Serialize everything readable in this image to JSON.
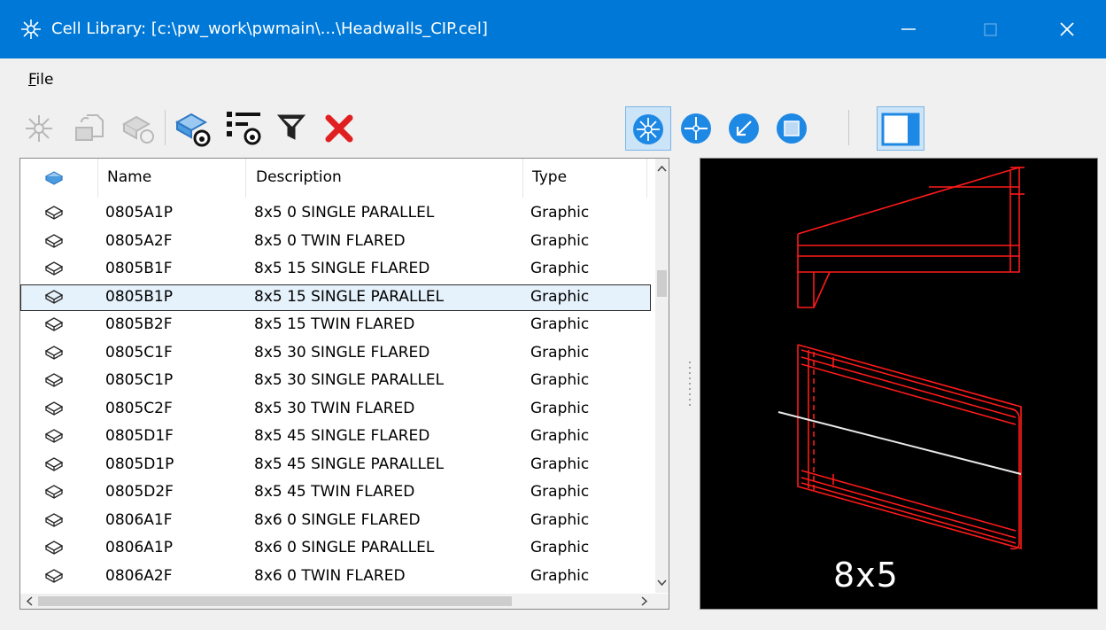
{
  "window": {
    "title": "Cell Library: [c:\\pw_work\\pwmain\\...\\Headwalls_CIP.cel]"
  },
  "menu": {
    "file_prefix": "F",
    "file_rest": "ile"
  },
  "toolbar": {
    "left_icons": [
      "place-cell-icon",
      "create-cell-icon",
      "update-cell-icon",
      "show-cells-icon",
      "show-details-icon",
      "filter-icon",
      "delete-icon"
    ],
    "right_icons": [
      "placement-active-point-icon",
      "placement-center-icon",
      "placement-origin-icon",
      "placement-fit-icon",
      "preview-pane-toggle-icon"
    ]
  },
  "table": {
    "columns": [
      "Name",
      "Description",
      "Type"
    ],
    "rows": [
      {
        "name": "0805A1P",
        "description": "8x5 0 SINGLE PARALLEL",
        "type": "Graphic"
      },
      {
        "name": "0805A2F",
        "description": "8x5 0 TWIN FLARED",
        "type": "Graphic"
      },
      {
        "name": "0805B1F",
        "description": "8x5 15 SINGLE FLARED",
        "type": "Graphic"
      },
      {
        "name": "0805B1P",
        "description": "8x5 15 SINGLE PARALLEL",
        "type": "Graphic",
        "selected": true
      },
      {
        "name": "0805B2F",
        "description": "8x5 15 TWIN FLARED",
        "type": "Graphic"
      },
      {
        "name": "0805C1F",
        "description": "8x5 30 SINGLE FLARED",
        "type": "Graphic"
      },
      {
        "name": "0805C1P",
        "description": "8x5 30 SINGLE PARALLEL",
        "type": "Graphic"
      },
      {
        "name": "0805C2F",
        "description": "8x5 30 TWIN FLARED",
        "type": "Graphic"
      },
      {
        "name": "0805D1F",
        "description": "8x5 45 SINGLE FLARED",
        "type": "Graphic"
      },
      {
        "name": "0805D1P",
        "description": "8x5 45 SINGLE PARALLEL",
        "type": "Graphic"
      },
      {
        "name": "0805D2F",
        "description": "8x5 45 TWIN FLARED",
        "type": "Graphic"
      },
      {
        "name": "0806A1F",
        "description": "8x6 0 SINGLE FLARED",
        "type": "Graphic"
      },
      {
        "name": "0806A1P",
        "description": "8x6 0 SINGLE PARALLEL",
        "type": "Graphic"
      },
      {
        "name": "0806A2F",
        "description": "8x6 0 TWIN FLARED",
        "type": "Graphic"
      }
    ]
  },
  "preview": {
    "label": "8x5"
  },
  "colors": {
    "titlebar": "#0078d7",
    "selection": "#e5f1fb",
    "preview_bg": "#000000",
    "drawing": "#ff0000",
    "accent": "#1e88e5"
  }
}
